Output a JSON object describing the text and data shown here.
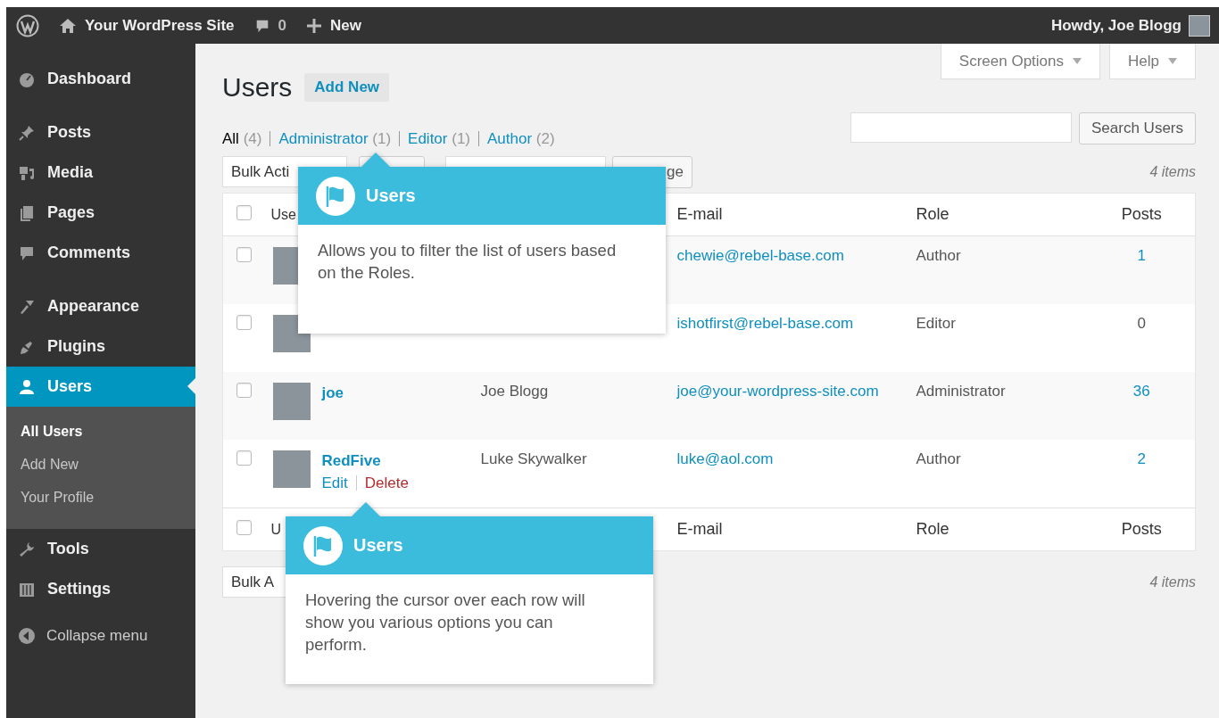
{
  "admin_bar": {
    "site": "Your WordPress Site",
    "comments": "0",
    "new": "New",
    "greeting": "Howdy, Joe Blogg"
  },
  "sidebar": {
    "groups": [
      [
        {
          "label": "Dashboard",
          "selected": false
        }
      ],
      [
        {
          "label": "Posts",
          "selected": false
        },
        {
          "label": "Media",
          "selected": false
        },
        {
          "label": "Pages",
          "selected": false
        },
        {
          "label": "Comments",
          "selected": false
        }
      ],
      [
        {
          "label": "Appearance",
          "selected": false
        },
        {
          "label": "Plugins",
          "selected": false
        },
        {
          "label": "Users",
          "selected": true,
          "children": [
            {
              "label": "All Users",
              "selected": true
            },
            {
              "label": "Add New",
              "selected": false
            },
            {
              "label": "Your Profile",
              "selected": false
            }
          ]
        },
        {
          "label": "Tools",
          "selected": false
        },
        {
          "label": "Settings",
          "selected": false
        }
      ]
    ],
    "collapse": "Collapse menu"
  },
  "screen_options": "Screen Options",
  "help": "Help",
  "page": {
    "title": "Users",
    "add_new": "Add New"
  },
  "filters": [
    {
      "label": "All",
      "count": "(4)",
      "selected": true
    },
    {
      "label": "Administrator",
      "count": "(1)",
      "selected": false
    },
    {
      "label": "Editor",
      "count": "(1)",
      "selected": false
    },
    {
      "label": "Author",
      "count": "(2)",
      "selected": false
    }
  ],
  "search": {
    "button": "Search Users"
  },
  "top_actions": {
    "bulk": "Bulk Acti",
    "change": "ge",
    "count": "4 items"
  },
  "table": {
    "header": {
      "checked": false,
      "columns": [
        "Use",
        "E-mail",
        "Role",
        "Posts"
      ]
    },
    "rows": [
      {
        "checked": false,
        "email": "chewie@rebel-base.com",
        "role": "Author",
        "posts": "1",
        "posts_linked": true
      },
      {
        "checked": false,
        "email": "ishotfirst@rebel-base.com",
        "role": "Editor",
        "posts": "0",
        "posts_linked": false
      },
      {
        "checked": false,
        "username": "joe",
        "name": "Joe Blogg",
        "email": "joe@your-wordpress-site.com",
        "role": "Administrator",
        "posts": "36",
        "posts_linked": true
      },
      {
        "checked": false,
        "username": "RedFive",
        "name": "Luke Skywalker",
        "email": "luke@aol.com",
        "role": "Author",
        "posts": "2",
        "posts_linked": true,
        "actions": [
          "Edit",
          "Delete"
        ]
      }
    ],
    "footer": {
      "checked": false,
      "columns": [
        "U",
        "E-mail",
        "Role",
        "Posts"
      ]
    }
  },
  "bottom_actions": {
    "bulk": "Bulk A",
    "count": "4 items"
  },
  "pointers": [
    {
      "title": "Users",
      "text": "Allows you to filter the list of users based on the Roles."
    },
    {
      "title": "Users",
      "text": "Hovering the cursor over each row will show you various options you can perform."
    }
  ]
}
